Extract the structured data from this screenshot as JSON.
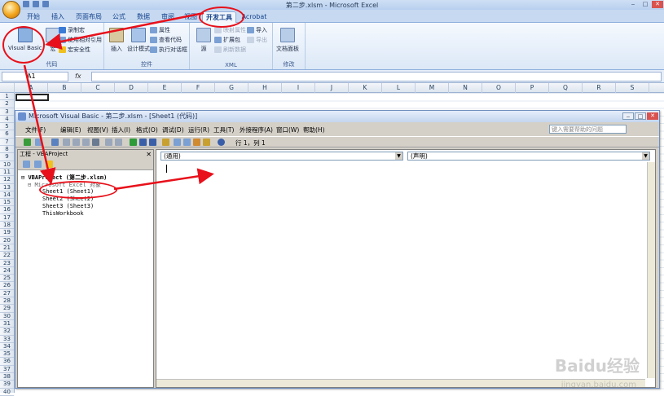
{
  "excel": {
    "title": "第二步.xlsm - Microsoft Excel",
    "tabs": [
      "开始",
      "插入",
      "页面布局",
      "公式",
      "数据",
      "审阅",
      "视图",
      "开发工具",
      "Acrobat"
    ],
    "active_tab": "开发工具",
    "ribbon": {
      "code_group": {
        "label": "代码",
        "visual_basic": "Visual Basic",
        "macros": "宏",
        "record_macro": "录制宏",
        "relative_ref": "使用相对引用",
        "macro_security": "宏安全性"
      },
      "controls_group": {
        "label": "控件",
        "insert": "插入",
        "design_mode": "设计模式",
        "properties": "属性",
        "view_code": "查看代码",
        "run_dialog": "执行对话框"
      },
      "xml_group": {
        "label": "XML",
        "source": "源",
        "map_props": "映射属性",
        "expansion_pack": "扩展包",
        "refresh_data": "刷新数据",
        "import": "导入",
        "export": "导出"
      },
      "modify_group": {
        "label": "修改",
        "doc_panel": "文档面板"
      }
    },
    "name_box": "A1",
    "fx": "fx",
    "columns": [
      "A",
      "B",
      "C",
      "D",
      "E",
      "F",
      "G",
      "H",
      "I",
      "J",
      "K",
      "L",
      "M",
      "N",
      "O",
      "P",
      "Q",
      "R",
      "S"
    ],
    "rows": [
      "1",
      "2",
      "3",
      "4",
      "5",
      "6",
      "7",
      "8",
      "9",
      "10",
      "11",
      "12",
      "13",
      "14",
      "15",
      "16",
      "17",
      "18",
      "19",
      "20",
      "21",
      "22",
      "23",
      "24",
      "25",
      "26",
      "27",
      "28",
      "29",
      "30",
      "31",
      "32",
      "33",
      "34",
      "35",
      "36",
      "37",
      "38",
      "39",
      "40"
    ]
  },
  "vbe": {
    "title": "Microsoft Visual Basic - 第二步.xlsm - [Sheet1 (代码)]",
    "menu": [
      "文件(F)",
      "编辑(E)",
      "视图(V)",
      "插入(I)",
      "格式(O)",
      "调试(D)",
      "运行(R)",
      "工具(T)",
      "外接程序(A)",
      "窗口(W)",
      "帮助(H)"
    ],
    "help_placeholder": "键入需要帮助的问题",
    "cursor_pos": "行 1，列 1",
    "project_title": "工程 - VBAProject",
    "tree": {
      "root": "VBAProject (第二步.xlsm)",
      "folder": "Microsoft Excel 对象",
      "items": [
        "Sheet1 (Sheet1)",
        "Sheet2 (Sheet2)",
        "Sheet3 (Sheet3)",
        "ThisWorkbook"
      ]
    },
    "object_combo": "(通用)",
    "proc_combo": "(声明)"
  },
  "watermark": {
    "main": "Baidu经验",
    "sub": "jingyan.baidu.com"
  },
  "colors": {
    "annotation": "#e8101a",
    "ribbon_bg": "#dce8f7",
    "accent": "#15428b"
  }
}
